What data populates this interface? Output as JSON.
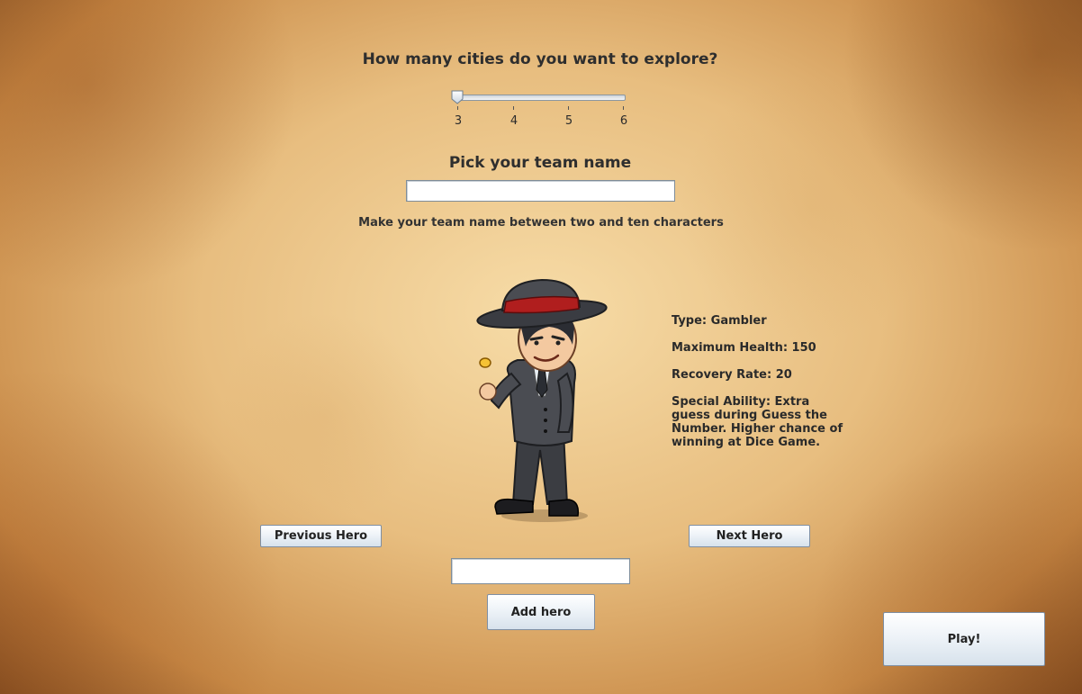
{
  "city_question": "How many cities do you want to explore?",
  "city_slider": {
    "min": 3,
    "max": 6,
    "value": 3,
    "ticks": [
      "3",
      "4",
      "5",
      "6"
    ]
  },
  "team": {
    "heading": "Pick your team name",
    "name_value": "",
    "hint": "Make your team name between two and ten characters"
  },
  "hero": {
    "type": "Type: Gambler",
    "max_health": "Maximum Health: 150",
    "recovery_rate": "Recovery Rate: 20",
    "special_ability": "Special Ability: Extra guess during Guess the Number. Higher chance of winning at Dice Game.",
    "image_icon": "gambler-hero-figure"
  },
  "buttons": {
    "previous": "Previous Hero",
    "next": "Next Hero",
    "add": "Add hero",
    "play": "Play!"
  },
  "hero_name_value": "",
  "colors": {
    "hat_band": "#b01e1e",
    "suit": "#3d3f44",
    "button_border": "#7f8fa3"
  }
}
